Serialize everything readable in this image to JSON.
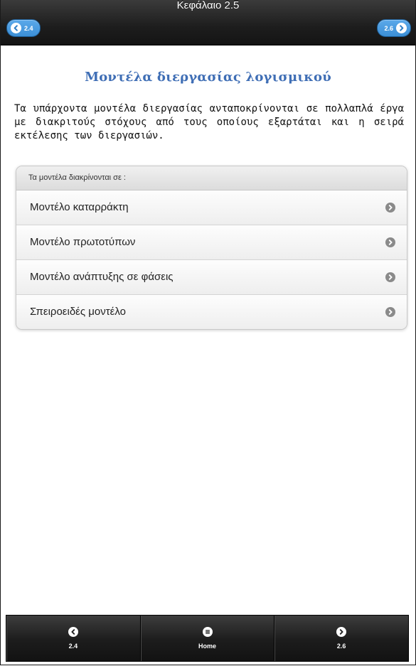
{
  "header": {
    "title": "Κεφάλαιο 2.5",
    "prev_label": "2.4",
    "next_label": "2.6",
    "prev_icon": "chevron-left-icon",
    "next_icon": "chevron-right-icon",
    "accent_color": "#3c8fd6"
  },
  "main": {
    "heading": "Μοντέλα διεργασίας λογισμικού",
    "intro": "Τα υπάρχοντα μοντέλα διεργασίας ανταποκρίνονται σε πολλαπλά έργα με διακριτούς στόχους από τους οποίους εξαρτάται και η σειρά εκτέλεσης των διεργασιών.",
    "list_header": "Τα μοντέλα διακρίνονται σε :",
    "items": [
      {
        "label": "Μοντέλο καταρράκτη",
        "icon": "chevron-right-icon"
      },
      {
        "label": "Μοντέλο πρωτοτύπων",
        "icon": "chevron-right-icon"
      },
      {
        "label": "Μοντέλο ανάπτυξης σε φάσεις",
        "icon": "chevron-right-icon"
      },
      {
        "label": "Σπειροειδές μοντέλο",
        "icon": "chevron-right-icon"
      }
    ],
    "heading_color": "#3f6eb5"
  },
  "footer": {
    "prev_label": "2.4",
    "home_label": "Home",
    "next_label": "2.6",
    "prev_icon": "chevron-left-icon",
    "home_icon": "menu-icon",
    "next_icon": "chevron-right-icon"
  }
}
